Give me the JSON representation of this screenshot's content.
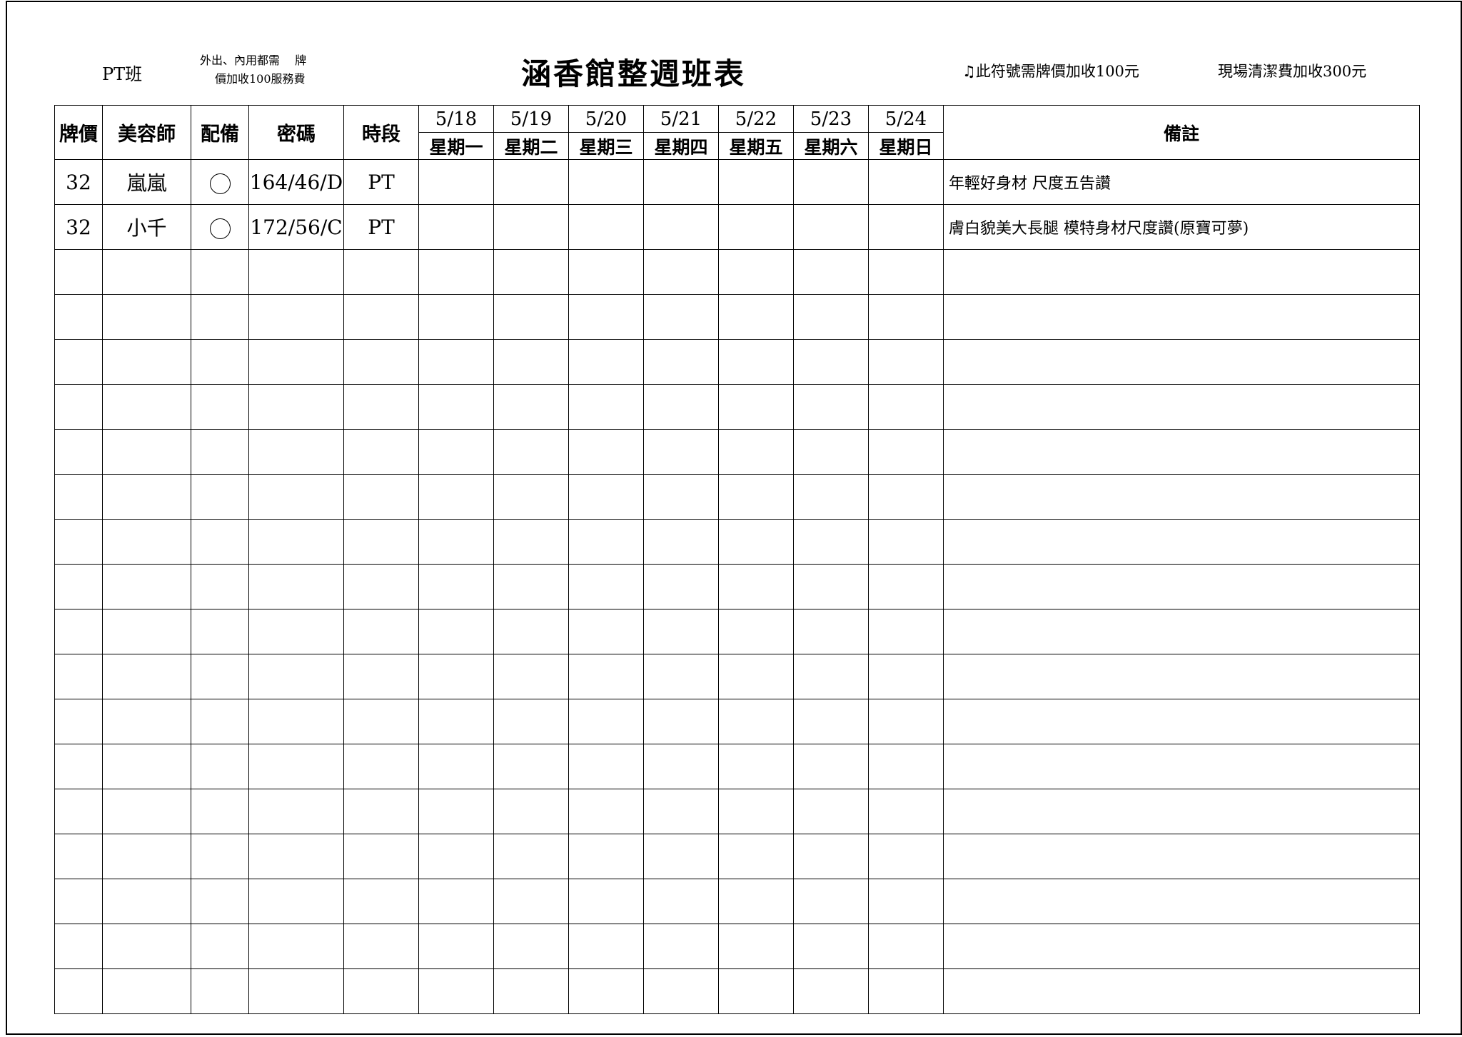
{
  "header": {
    "class_label": "PT班",
    "note_small_line1": "外出、內用都需　 牌",
    "note_small_line2": "價加收100服務費",
    "title": "涵香館整週班表",
    "note_right_symbol": "♫",
    "note_right_text": "此符號需牌價加收100元",
    "note_cleaning": "現場清潔費加收300元"
  },
  "columns": {
    "price": "牌價",
    "stylist": "美容師",
    "equipment": "配備",
    "code": "密碼",
    "period": "時段",
    "remarks": "備註",
    "days": [
      {
        "date": "5/18",
        "weekday": "星期一"
      },
      {
        "date": "5/19",
        "weekday": "星期二"
      },
      {
        "date": "5/20",
        "weekday": "星期三"
      },
      {
        "date": "5/21",
        "weekday": "星期四"
      },
      {
        "date": "5/22",
        "weekday": "星期五"
      },
      {
        "date": "5/23",
        "weekday": "星期六"
      },
      {
        "date": "5/24",
        "weekday": "星期日"
      }
    ]
  },
  "rows": [
    {
      "price": "32",
      "stylist": "嵐嵐",
      "equipment": "circle",
      "code": "164/46/D",
      "period": "PT",
      "remark": "年輕好身材 尺度五告讚"
    },
    {
      "price": "32",
      "stylist": "小千",
      "equipment": "circle",
      "code": "172/56/C",
      "period": "PT",
      "remark": "膚白貌美大長腿 模特身材尺度讚(原寶可夢)"
    },
    {},
    {},
    {},
    {},
    {},
    {},
    {},
    {},
    {},
    {},
    {},
    {},
    {},
    {},
    {},
    {},
    {}
  ]
}
